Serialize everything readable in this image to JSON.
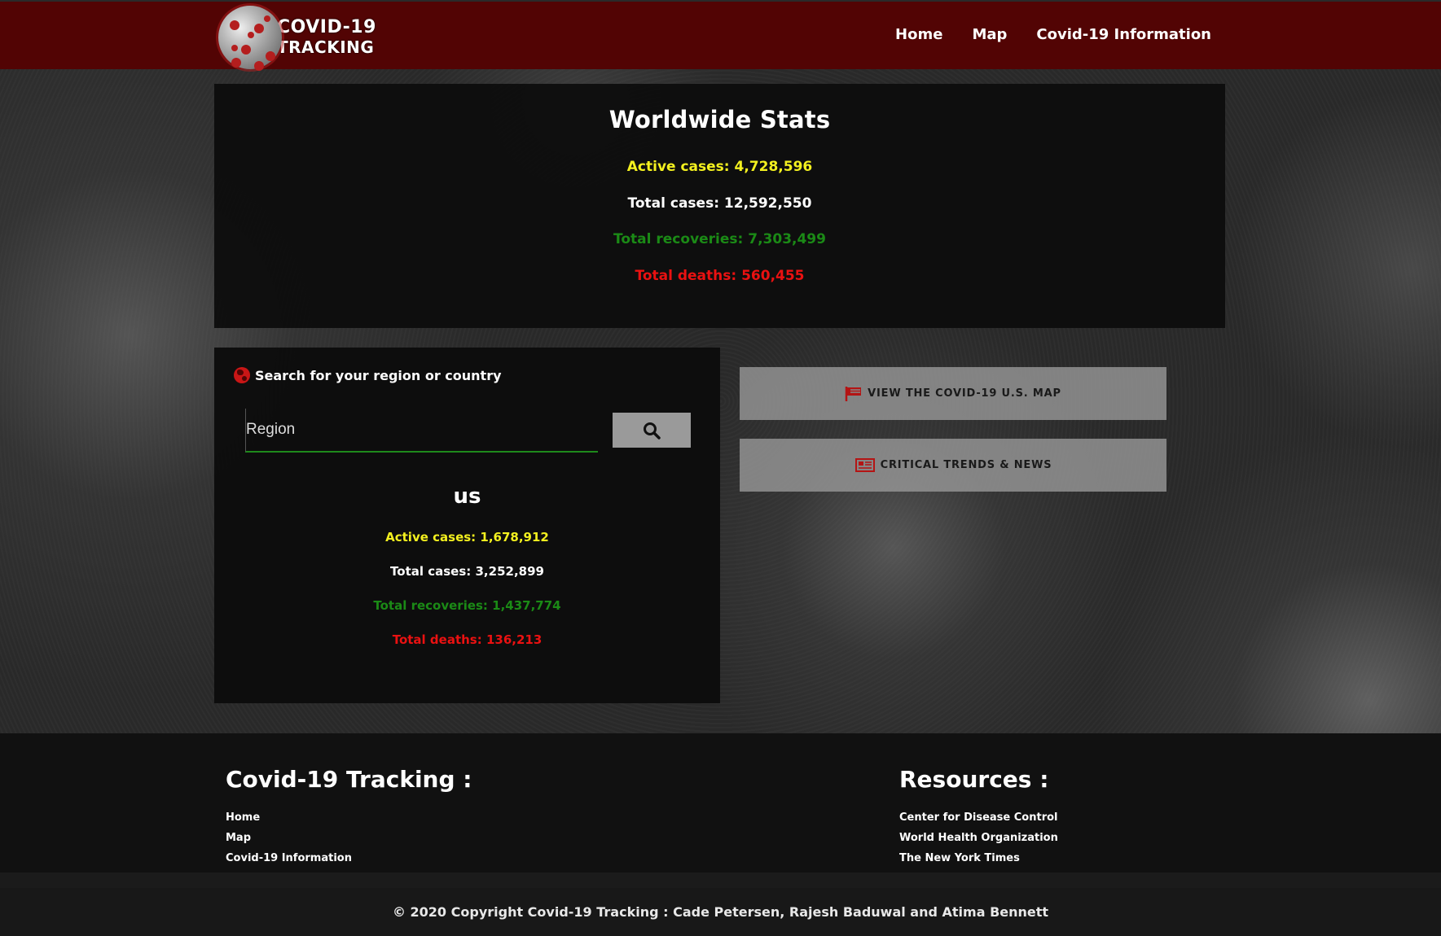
{
  "header": {
    "logo_line1": "COVID-19",
    "logo_line2": "TRACKING",
    "nav": [
      "Home",
      "Map",
      "Covid-19 Information"
    ]
  },
  "world": {
    "title": "Worldwide Stats",
    "active": "Active cases: 4,728,596",
    "total": "Total cases: 12,592,550",
    "recoveries": "Total recoveries: 7,303,499",
    "deaths": "Total deaths: 560,455"
  },
  "region": {
    "heading": "Search for your region or country",
    "search_placeholder": "Region",
    "name": "us",
    "active": "Active cases: 1,678,912",
    "total": "Total cases: 3,252,899",
    "recoveries": "Total recoveries: 1,437,774",
    "deaths": "Total deaths: 136,213"
  },
  "actions": {
    "map_button": "VIEW THE COVID-19 U.S. MAP",
    "news_button": "CRITICAL TRENDS & NEWS"
  },
  "footer": {
    "col1_title": "Covid-19 Tracking :",
    "col1_links": [
      "Home",
      "Map",
      "Covid-19 Information"
    ],
    "col2_title": "Resources :",
    "col2_links": [
      "Center for Disease Control",
      "World Health Organization",
      "The New York Times"
    ],
    "copyright": "© 2020 Copyright Covid-19 Tracking : Cade Petersen, Rajesh Baduwal and Atima Bennett"
  },
  "colors": {
    "header_bg": "#520404",
    "active": "#f3f01f",
    "recoveries": "#1b8a16",
    "deaths": "#ea1111"
  },
  "icons": {
    "logo": "virus-logo-icon",
    "region": "globe-icon",
    "search": "search-icon",
    "map": "flag-icon",
    "news": "newspaper-icon"
  }
}
